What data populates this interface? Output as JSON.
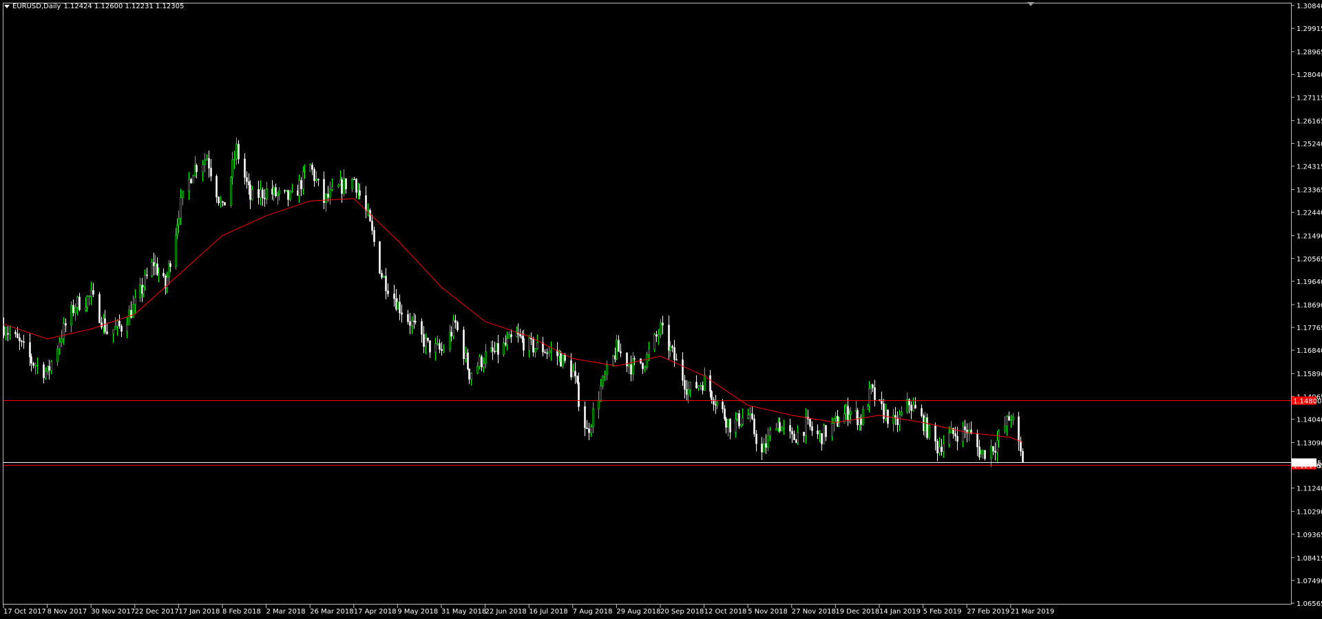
{
  "header": {
    "symbol": "EURUSD,Daily",
    "ohlc": "1.12424 1.12600 1.12231 1.12305"
  },
  "colors": {
    "background": "#000000",
    "frame": "#c0c0c0",
    "text": "#ffffff",
    "bull_candle": "#00ff00",
    "bear_candle": "#ffffff",
    "moving_average": "#ff0000",
    "hline": "#ff0000",
    "hline_label_bg": "#ff0000",
    "bid_line": "#ffffff"
  },
  "chart_data": {
    "type": "candlestick",
    "title": "EURUSD,Daily",
    "ylim": [
      1.06565,
      1.3084
    ],
    "y_ticks": [
      "1.30840",
      "1.29915",
      "1.28965",
      "1.28040",
      "1.27115",
      "1.26165",
      "1.25240",
      "1.24315",
      "1.23365",
      "1.22440",
      "1.21490",
      "1.20565",
      "1.19640",
      "1.18690",
      "1.17765",
      "1.16840",
      "1.15890",
      "1.14965",
      "1.14040",
      "1.13090",
      "1.12165",
      "1.11240",
      "1.10290",
      "1.09365",
      "1.08415",
      "1.07490",
      "1.06565"
    ],
    "x_labels": [
      "17 Oct 2017",
      "8 Nov 2017",
      "30 Nov 2017",
      "22 Dec 2017",
      "17 Jan 2018",
      "8 Feb 2018",
      "2 Mar 2018",
      "26 Mar 2018",
      "17 Apr 2018",
      "9 May 2018",
      "31 May 2018",
      "22 Jun 2018",
      "16 Jul 2018",
      "7 Aug 2018",
      "29 Aug 2018",
      "20 Sep 2018",
      "12 Oct 2018",
      "5 Nov 2018",
      "27 Nov 2018",
      "19 Dec 2018",
      "14 Jan 2019",
      "5 Feb 2019",
      "27 Feb 2019",
      "21 Mar 2019"
    ],
    "price_path": [
      [
        "17 Oct 2017",
        1.178
      ],
      [
        "24 Oct 2017",
        1.172
      ],
      [
        "31 Oct 2017",
        1.164
      ],
      [
        "8 Nov 2017",
        1.159
      ],
      [
        "15 Nov 2017",
        1.175
      ],
      [
        "22 Nov 2017",
        1.187
      ],
      [
        "30 Nov 2017",
        1.19
      ],
      [
        "8 Dec 2017",
        1.176
      ],
      [
        "15 Dec 2017",
        1.178
      ],
      [
        "22 Dec 2017",
        1.187
      ],
      [
        "2 Jan 2018",
        1.204
      ],
      [
        "9 Jan 2018",
        1.194
      ],
      [
        "17 Jan 2018",
        1.225
      ],
      [
        "24 Jan 2018",
        1.242
      ],
      [
        "31 Jan 2018",
        1.247
      ],
      [
        "8 Feb 2018",
        1.225
      ],
      [
        "15 Feb 2018",
        1.25
      ],
      [
        "22 Feb 2018",
        1.23
      ],
      [
        "2 Mar 2018",
        1.233
      ],
      [
        "9 Mar 2018",
        1.231
      ],
      [
        "16 Mar 2018",
        1.23
      ],
      [
        "26 Mar 2018",
        1.243
      ],
      [
        "2 Apr 2018",
        1.229
      ],
      [
        "9 Apr 2018",
        1.234
      ],
      [
        "17 Apr 2018",
        1.238
      ],
      [
        "24 Apr 2018",
        1.222
      ],
      [
        "1 May 2018",
        1.199
      ],
      [
        "9 May 2018",
        1.187
      ],
      [
        "16 May 2018",
        1.179
      ],
      [
        "24 May 2018",
        1.17
      ],
      [
        "31 May 2018",
        1.168
      ],
      [
        "7 Jun 2018",
        1.179
      ],
      [
        "14 Jun 2018",
        1.159
      ],
      [
        "22 Jun 2018",
        1.166
      ],
      [
        "29 Jun 2018",
        1.168
      ],
      [
        "9 Jul 2018",
        1.174
      ],
      [
        "16 Jul 2018",
        1.17
      ],
      [
        "23 Jul 2018",
        1.169
      ],
      [
        "31 Jul 2018",
        1.166
      ],
      [
        "7 Aug 2018",
        1.159
      ],
      [
        "14 Aug 2018",
        1.135
      ],
      [
        "21 Aug 2018",
        1.153
      ],
      [
        "29 Aug 2018",
        1.169
      ],
      [
        "5 Sep 2018",
        1.162
      ],
      [
        "12 Sep 2018",
        1.164
      ],
      [
        "20 Sep 2018",
        1.177
      ],
      [
        "27 Sep 2018",
        1.165
      ],
      [
        "4 Oct 2018",
        1.152
      ],
      [
        "12 Oct 2018",
        1.156
      ],
      [
        "19 Oct 2018",
        1.147
      ],
      [
        "26 Oct 2018",
        1.138
      ],
      [
        "5 Nov 2018",
        1.142
      ],
      [
        "12 Nov 2018",
        1.126
      ],
      [
        "19 Nov 2018",
        1.14
      ],
      [
        "27 Nov 2018",
        1.132
      ],
      [
        "4 Dec 2018",
        1.138
      ],
      [
        "11 Dec 2018",
        1.133
      ],
      [
        "19 Dec 2018",
        1.139
      ],
      [
        "27 Dec 2018",
        1.144
      ],
      [
        "3 Jan 2019",
        1.14
      ],
      [
        "9 Jan 2019",
        1.152
      ],
      [
        "14 Jan 2019",
        1.145
      ],
      [
        "22 Jan 2019",
        1.138
      ],
      [
        "29 Jan 2019",
        1.147
      ],
      [
        "5 Feb 2019",
        1.139
      ],
      [
        "12 Feb 2019",
        1.129
      ],
      [
        "19 Feb 2019",
        1.134
      ],
      [
        "27 Feb 2019",
        1.136
      ],
      [
        "6 Mar 2019",
        1.126
      ],
      [
        "13 Mar 2019",
        1.13
      ],
      [
        "21 Mar 2019",
        1.142
      ],
      [
        "27 Mar 2019",
        1.123
      ]
    ],
    "moving_average": [
      [
        "17 Oct 2017",
        1.179
      ],
      [
        "8 Nov 2017",
        1.173
      ],
      [
        "30 Nov 2017",
        1.177
      ],
      [
        "22 Dec 2017",
        1.183
      ],
      [
        "17 Jan 2018",
        1.199
      ],
      [
        "8 Feb 2018",
        1.215
      ],
      [
        "2 Mar 2018",
        1.223
      ],
      [
        "26 Mar 2018",
        1.229
      ],
      [
        "17 Apr 2018",
        1.23
      ],
      [
        "9 May 2018",
        1.213
      ],
      [
        "31 May 2018",
        1.194
      ],
      [
        "22 Jun 2018",
        1.18
      ],
      [
        "16 Jul 2018",
        1.174
      ],
      [
        "7 Aug 2018",
        1.165
      ],
      [
        "29 Aug 2018",
        1.162
      ],
      [
        "20 Sep 2018",
        1.166
      ],
      [
        "12 Oct 2018",
        1.158
      ],
      [
        "5 Nov 2018",
        1.146
      ],
      [
        "27 Nov 2018",
        1.142
      ],
      [
        "19 Dec 2018",
        1.139
      ],
      [
        "14 Jan 2019",
        1.142
      ],
      [
        "5 Feb 2019",
        1.139
      ],
      [
        "27 Feb 2019",
        1.135
      ],
      [
        "21 Mar 2019",
        1.133
      ],
      [
        "27 Mar 2019",
        1.131
      ]
    ],
    "horizontal_lines": [
      {
        "label": "1.14800",
        "price": 1.148
      },
      {
        "label": "1.12175",
        "price": 1.12175
      }
    ],
    "bid_line": {
      "label": "1.12305",
      "price": 1.12305
    }
  }
}
